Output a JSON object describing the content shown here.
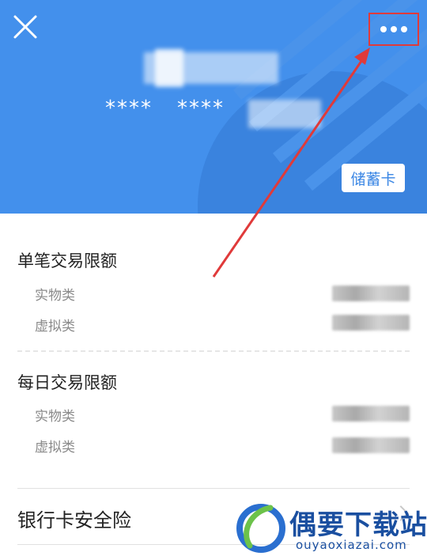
{
  "header": {
    "close_icon": "close-icon",
    "more_icon": "more-dots-icon",
    "masked_group_1": "****",
    "masked_group_2": "****",
    "card_type": "储蓄卡"
  },
  "single_limit": {
    "title": "单笔交易限额",
    "rows": [
      {
        "label": "实物类"
      },
      {
        "label": "虚拟类"
      }
    ]
  },
  "daily_limit": {
    "title": "每日交易限额",
    "rows": [
      {
        "label": "实物类"
      },
      {
        "label": "虚拟类"
      }
    ]
  },
  "insurance": {
    "label": "银行卡安全险"
  },
  "watermark": {
    "cn": "偶要下载站",
    "en": "ouyaoxiazai.com"
  },
  "colors": {
    "header_bg": "#4390ec",
    "annotation": "#e03a3a",
    "watermark": "#1a4fa0"
  }
}
